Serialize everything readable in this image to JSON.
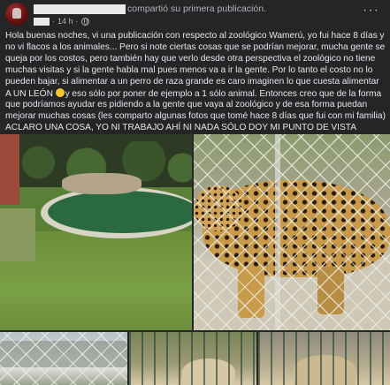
{
  "post": {
    "header": {
      "shared_text": "compartió su primera publicación.",
      "time": "14 h",
      "separator": "·",
      "more_label": "···"
    },
    "body": {
      "text_before_emoji": "Hola buenas noches, vi una publicación con respecto al zoológico Wamerú, yo fui hace 8 días y no vi flacos a los animales... Pero si note ciertas cosas que se podrían mejorar, mucha gente se queja por los costos, pero también hay que verlo desde otra perspectiva el zoológico no tiene muchas visitas y si la gente habla mal pues menos va a ir la gente. Por lo tanto el costo no lo pueden bajar, si alimentar a un perro de raza grande es caro imaginen lo que cuesta alimentar  A UN LEÓN",
      "emoji_name": "slightly-smiling-face",
      "text_after_emoji": "y eso sólo por poner de ejemplo a 1 sólo animal. Entonces creo que de la forma que podríamos ayudar es pidiendo a la gente que vaya al zoológico y de esa forma puedan mejorar muchas cosas (les comparto algunas fotos que tomé hace 8 días que fui con mi familia) ACLARO UNA COSA, YO NI TRABAJO AHÍ NI NADA SÓLO DOY MI PUNTO DE VISTA"
    },
    "photos": [
      {
        "subject": "pond-enclosure"
      },
      {
        "subject": "jaguar-behind-fence"
      },
      {
        "subject": "fenced-enclosure"
      },
      {
        "subject": "animal-behind-bars"
      },
      {
        "subject": "animal-behind-bars"
      }
    ]
  },
  "colors": {
    "background": "#242526",
    "text_primary": "#e4e6eb",
    "text_secondary": "#b0b3b8"
  }
}
